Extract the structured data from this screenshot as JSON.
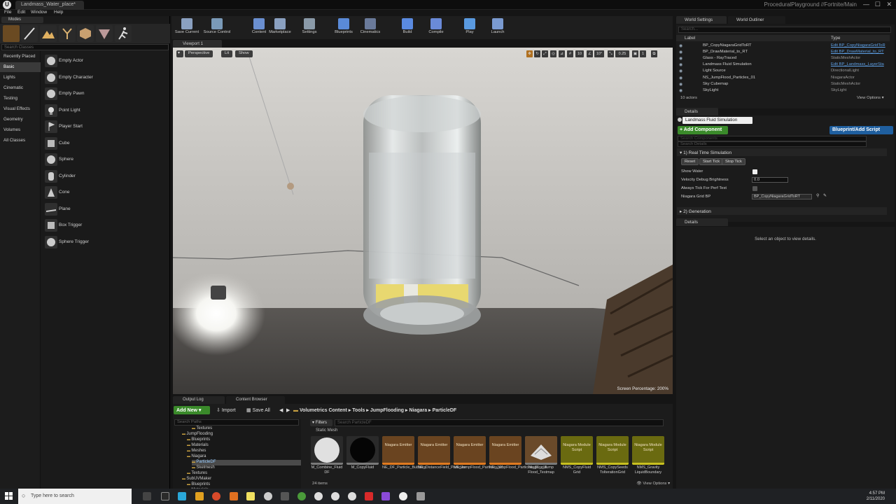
{
  "window": {
    "doc_tab": "Landmass_Water_place*",
    "project": "ProceduralPlayground //Fortnite/Main"
  },
  "menu": [
    "File",
    "Edit",
    "Window",
    "Help"
  ],
  "modes": {
    "header": "Modes",
    "search_placeholder": "Search Classes",
    "categories": [
      "Recently Placed",
      "Basic",
      "Lights",
      "Cinematic",
      "Testing",
      "Visual Effects",
      "Geometry",
      "Volumes",
      "All Classes"
    ],
    "selected_category": "Basic",
    "actors": [
      "Empty Actor",
      "Empty Character",
      "Empty Pawn",
      "Point Light",
      "Player Start",
      "Cube",
      "Sphere",
      "Cylinder",
      "Cone",
      "Plane",
      "Box Trigger",
      "Sphere Trigger"
    ]
  },
  "toolbar": [
    {
      "label": "Save Current",
      "icon": "save-icon"
    },
    {
      "label": "Source Control",
      "icon": "source-control-icon"
    },
    {
      "label": "Content",
      "icon": "content-icon"
    },
    {
      "label": "Marketplace",
      "icon": "marketplace-icon"
    },
    {
      "label": "Settings",
      "icon": "settings-icon"
    },
    {
      "label": "Blueprints",
      "icon": "blueprints-icon"
    },
    {
      "label": "Cinematics",
      "icon": "cinematics-icon"
    },
    {
      "label": "Build",
      "icon": "build-icon"
    },
    {
      "label": "Compile",
      "icon": "compile-icon"
    },
    {
      "label": "Play",
      "icon": "play-icon"
    },
    {
      "label": "Launch",
      "icon": "launch-icon"
    }
  ],
  "viewport": {
    "tab": "Viewport 1",
    "perspective": "Perspective",
    "lit": "Lit",
    "show": "Show",
    "grid_snap": "10",
    "rot_snap": "10°",
    "scale_snap": "0.25",
    "cam_speed": "1",
    "screen_percentage": "Screen Percentage: 200%"
  },
  "bottom": {
    "tabs": [
      "Output Log",
      "Content Browser"
    ],
    "add_new": "Add New",
    "import": "Import",
    "save_all": "Save All",
    "breadcrumbs": [
      "Volumetrics Content",
      "Tools",
      "JumpFlooding",
      "Niagara",
      "ParticleDF"
    ],
    "tree_search": "Search Paths",
    "tree": [
      {
        "label": "Textures",
        "indent": 3
      },
      {
        "label": "JumpFlooding",
        "indent": 1
      },
      {
        "label": "Blueprints",
        "indent": 2
      },
      {
        "label": "Materials",
        "indent": 2
      },
      {
        "label": "Meshes",
        "indent": 2
      },
      {
        "label": "Niagara",
        "indent": 2
      },
      {
        "label": "ParticleDF",
        "indent": 3,
        "selected": true
      },
      {
        "label": "Skelmesh",
        "indent": 3
      },
      {
        "label": "Textures",
        "indent": 2
      },
      {
        "label": "SubUVMaker",
        "indent": 1
      },
      {
        "label": "Blueprints",
        "indent": 2
      },
      {
        "label": "Materials",
        "indent": 2
      }
    ],
    "filters": "Filters",
    "asset_search": "Search ParticleDF",
    "asset_type_header": "Static Mesh",
    "assets": [
      {
        "name": "M_Combine_Fluid DF",
        "kind": "sphere-white",
        "thumb": ""
      },
      {
        "name": "M_CopyFluid",
        "kind": "sphere-black",
        "thumb": ""
      },
      {
        "name": "NE_DF_Particle_Bubbles",
        "kind": "emitter",
        "thumb": "Niagara Emitter"
      },
      {
        "name": "NE_DistanceField_Particles",
        "kind": "emitter",
        "thumb": "Niagara Emitter"
      },
      {
        "name": "NE_JumpFlood_Particles_01",
        "kind": "emitter",
        "thumb": "Niagara Emitter"
      },
      {
        "name": "NE_JumpFlood_Particles_01_old",
        "kind": "emitter",
        "thumb": "Niagara Emitter"
      },
      {
        "name": "Niagara_Jump Flood_Testmap",
        "kind": "map",
        "thumb": ""
      },
      {
        "name": "NMS_CopyFluid Grid",
        "kind": "module",
        "thumb": "Niagara Module Script"
      },
      {
        "name": "NMS_CopySeeds ToIterationGrid",
        "kind": "module",
        "thumb": "Niagara Module Script"
      },
      {
        "name": "NMS_Gravity LiquidBoundary",
        "kind": "module",
        "thumb": "Niagara Module Script"
      }
    ],
    "items_count": "24 items",
    "view_options": "View Options"
  },
  "right": {
    "tabs": [
      "World Settings",
      "World Outliner"
    ],
    "outliner_search": "Search...",
    "col_label": "Label",
    "col_type": "Type",
    "rows": [
      {
        "label": "BP_CopyNiagaraGridToRT",
        "type": "Edit BP_CopyNiagaraGridToR",
        "link": true
      },
      {
        "label": "BP_DrawMaterial_to_RT",
        "type": "Edit BP_DrawMaterial_to_RT",
        "link": true
      },
      {
        "label": "Glass - RayTraced",
        "type": "StaticMeshActor",
        "link": false
      },
      {
        "label": "Landmass Fluid Simulation",
        "type": "Edit BP_Landmass_LayerSta",
        "link": true
      },
      {
        "label": "Light Source",
        "type": "DirectionalLight",
        "link": false
      },
      {
        "label": "NS_JumpFlood_Particles_01",
        "type": "NiagaraActor",
        "link": false
      },
      {
        "label": "Sky Cubemap",
        "type": "StaticMeshActor",
        "link": false
      },
      {
        "label": "SkyLight",
        "type": "SkyLight",
        "link": false
      }
    ],
    "actor_count": "10 actors",
    "view_options": "View Options",
    "details_tab": "Details",
    "selected_name": "Landmass Fluid Simulation",
    "add_component": "+ Add Component",
    "blueprint_script": "Blueprint/Add Script",
    "search_components": "Search Components",
    "search_details": "Search Details",
    "section1": "1) Real Time Simulation",
    "btn_reset": "Reset",
    "btn_start": "Start Tick",
    "btn_stop": "Stop Tick",
    "prop_show_water": "Show Water",
    "prop_velocity": "Velocity Debug Brightness",
    "velocity_value": "0.0",
    "prop_always_tick": "Always Tick For Perf Test",
    "prop_niagara": "Niagara Grid BP",
    "niagara_value": "BP_CopyNiagaraGridToRT",
    "section2": "2) Generation",
    "details2_tab": "Details",
    "details2_msg": "Select an object to view details."
  },
  "taskbar": {
    "search": "Type here to search",
    "time": "4:57 PM",
    "date": "2/11/2020"
  }
}
